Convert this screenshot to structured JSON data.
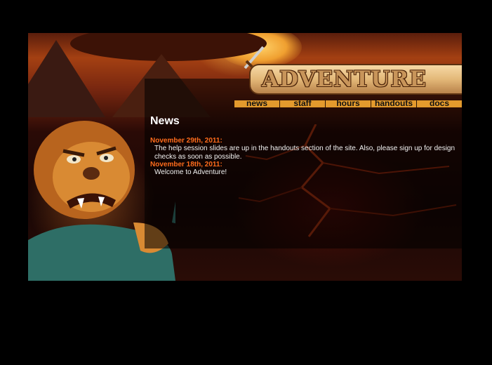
{
  "site": {
    "logo_text": "ADVENTURE"
  },
  "nav": {
    "items": [
      {
        "label": "news"
      },
      {
        "label": "staff"
      },
      {
        "label": "hours"
      },
      {
        "label": "handouts"
      },
      {
        "label": "docs"
      }
    ]
  },
  "news": {
    "heading": "News",
    "entries": [
      {
        "date": "November 29th, 2011:",
        "body": "The help session slides are up in the handouts section of the site. Also, please sign up for design\nchecks as soon as possible."
      },
      {
        "date": "November 18th, 2011:",
        "body": "Welcome to Adventure!"
      }
    ]
  },
  "colors": {
    "page_background": "#000000",
    "nav_bar": "#e39a2d",
    "date_text": "#ff6c1c",
    "body_text": "#f2f2f2"
  }
}
